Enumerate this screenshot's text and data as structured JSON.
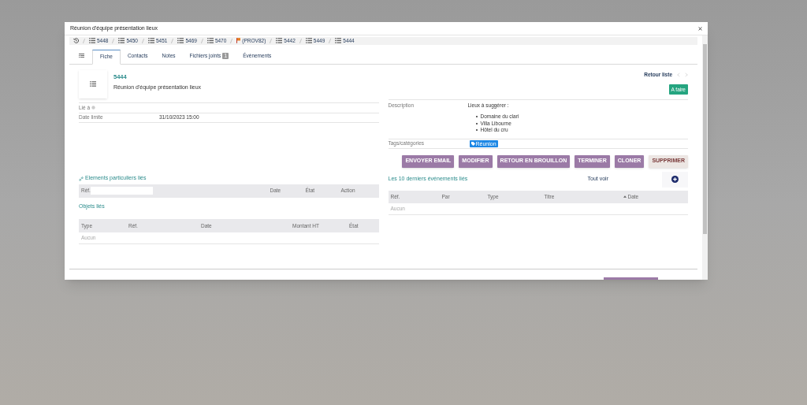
{
  "dialog": {
    "title": "Réunion d'équipe présentation lieux"
  },
  "breadcrumbs": [
    {
      "label": "5448",
      "kind": "list"
    },
    {
      "label": "5450",
      "kind": "list"
    },
    {
      "label": "5451",
      "kind": "list"
    },
    {
      "label": "5469",
      "kind": "list"
    },
    {
      "label": "5470",
      "kind": "list"
    },
    {
      "label": "(PROV82)",
      "kind": "flag"
    },
    {
      "label": "5442",
      "kind": "list"
    },
    {
      "label": "5449",
      "kind": "list"
    },
    {
      "label": "5444",
      "kind": "list"
    }
  ],
  "tabs": [
    {
      "label": "Fiche",
      "selected": true
    },
    {
      "label": "Contacts",
      "selected": false
    },
    {
      "label": "Notes",
      "selected": false
    },
    {
      "label": "Fichiers joints",
      "badge": "1",
      "selected": false
    },
    {
      "label": "Événements",
      "selected": false
    }
  ],
  "record": {
    "ref": "5444",
    "label": "Réunion d'équipe présentation lieux",
    "back_link": "Retour liste",
    "status": "A faire"
  },
  "left_fields": [
    {
      "label": "Lié à",
      "help": true
    },
    {
      "label": "Date limite",
      "help": false,
      "value": "31/10/2023 15:00"
    }
  ],
  "description": {
    "label": "Description",
    "intro": "Lieux à suggérer :",
    "items": [
      "Domaine du clari",
      "Villa Libourne",
      "Hôtel du cru"
    ]
  },
  "tags": {
    "label": "Tags/catégories",
    "values": [
      "Réunion"
    ]
  },
  "actions": [
    {
      "label": "ENVOYER EMAIL",
      "kind": "primary"
    },
    {
      "label": "MODIFIER",
      "kind": "primary"
    },
    {
      "label": "RETOUR EN BROUILLON",
      "kind": "primary"
    },
    {
      "label": "TERMINER",
      "kind": "primary"
    },
    {
      "label": "CLONER",
      "kind": "primary"
    },
    {
      "label": "SUPPRIMER",
      "kind": "danger"
    }
  ],
  "linked_elements": {
    "title": "Elements particuliers liés",
    "ref_label": "Réf.",
    "columns": [
      "Date",
      "État",
      "Action"
    ]
  },
  "linked_objects": {
    "title": "Objets liés",
    "columns": [
      "Type",
      "Réf.",
      "Date",
      "Montant HT",
      "État"
    ],
    "empty": "Aucun"
  },
  "events": {
    "title": "Les 10 derniers événements liés",
    "see_all": "Tout voir",
    "columns": [
      "Réf.",
      "Par",
      "Type",
      "Titre",
      "Date"
    ],
    "empty": "Aucun"
  }
}
